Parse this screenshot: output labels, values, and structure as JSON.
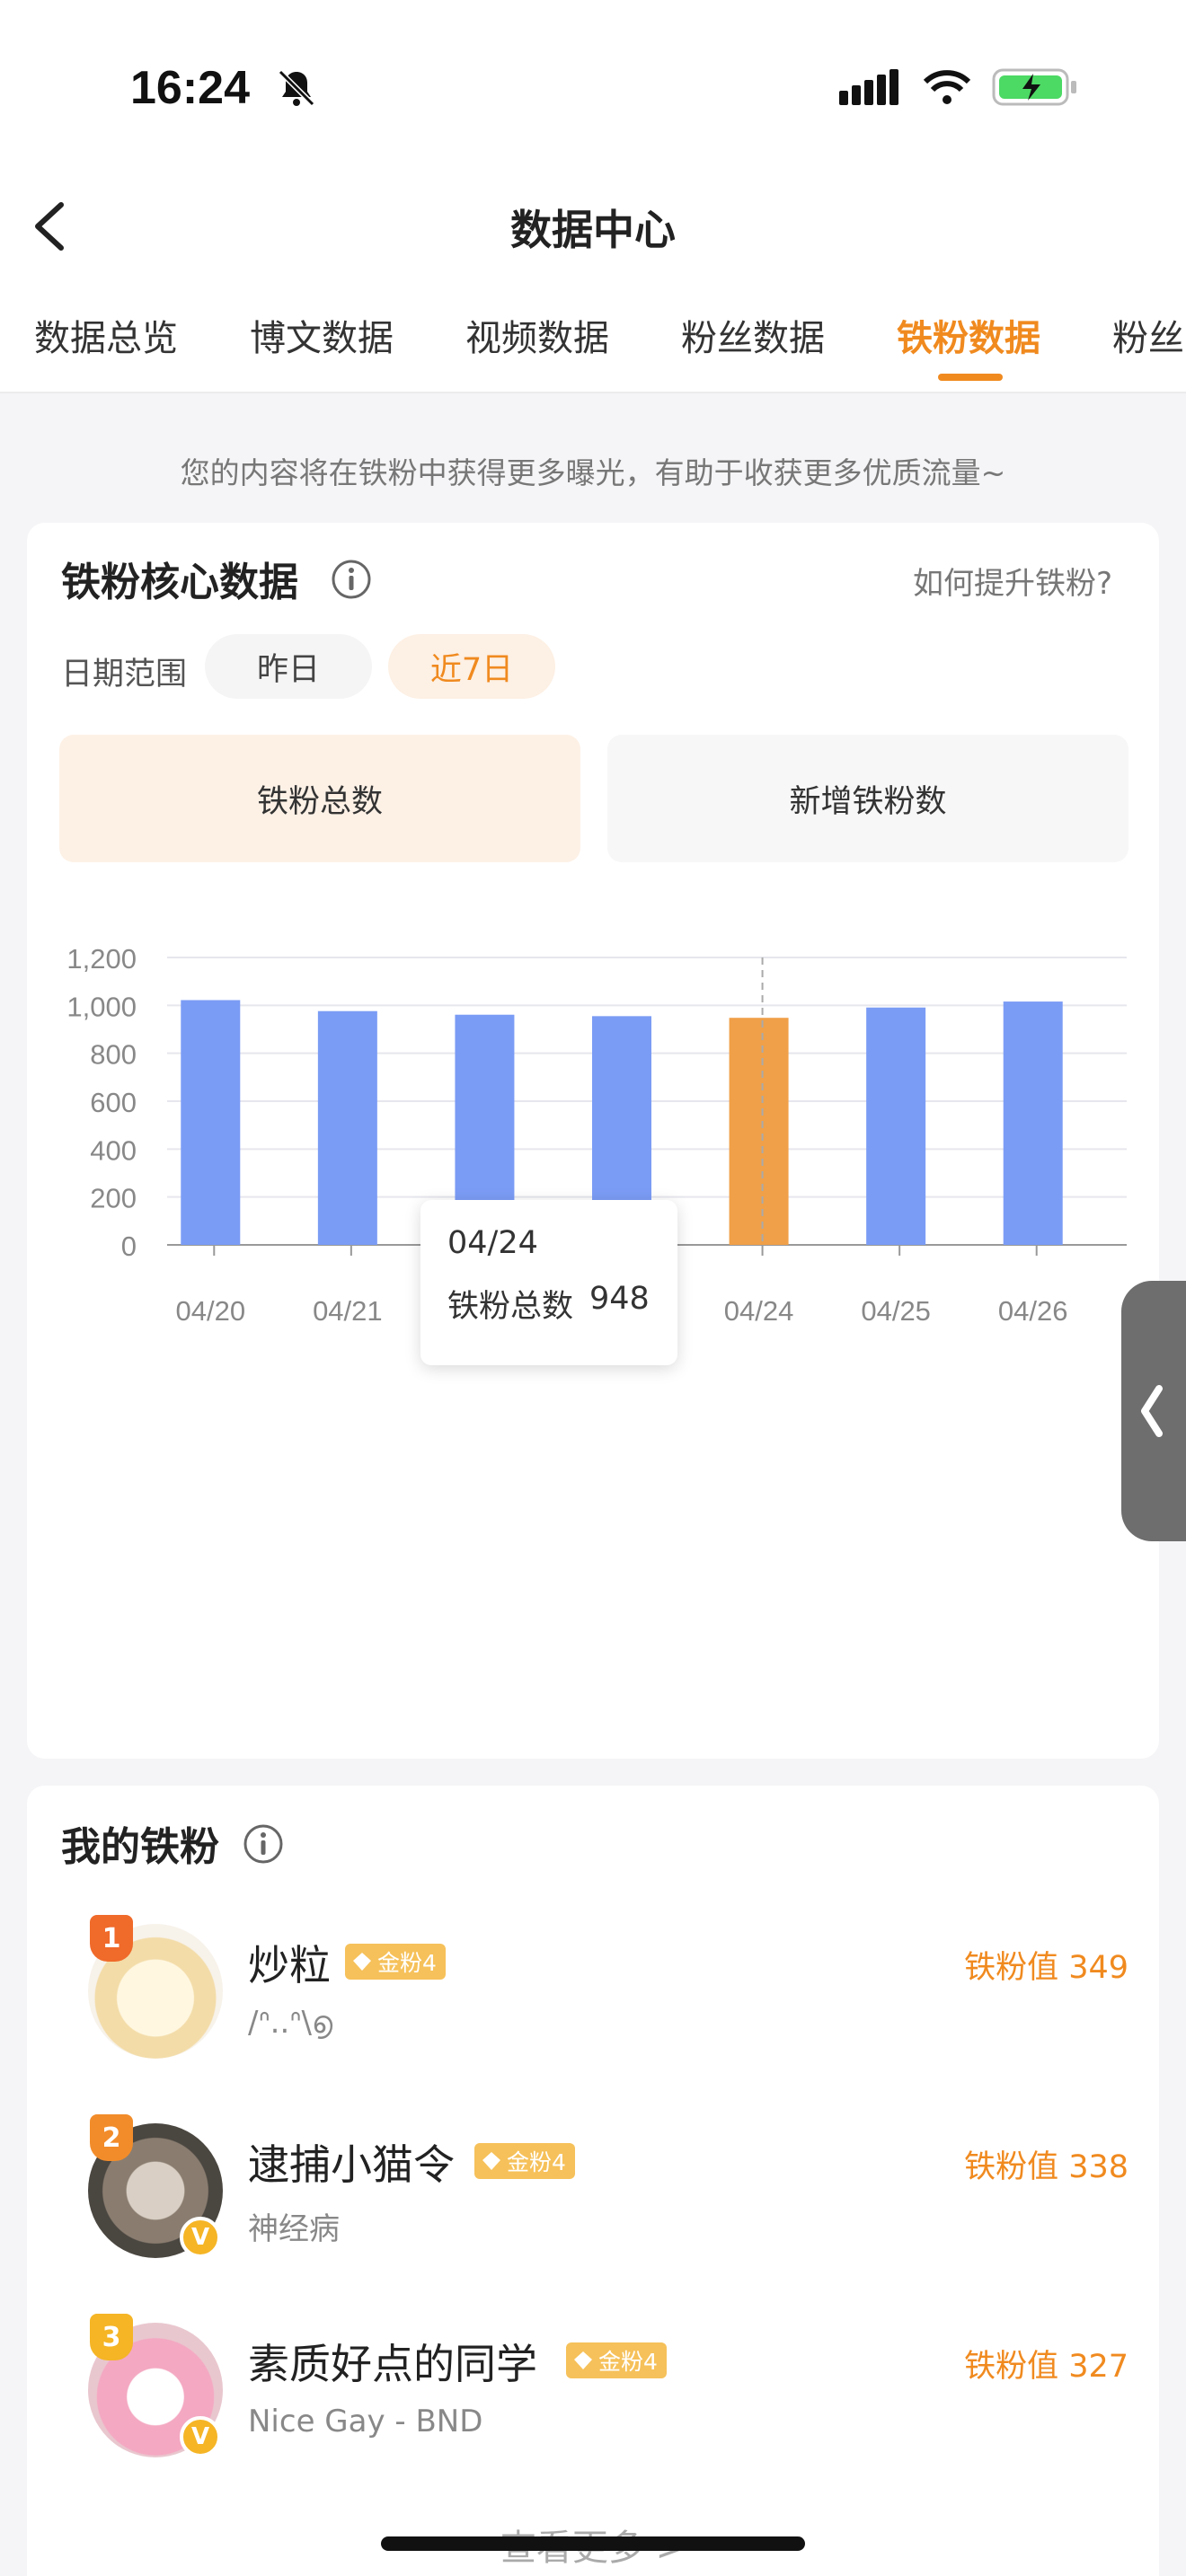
{
  "status": {
    "time": "16:24"
  },
  "nav": {
    "title": "数据中心"
  },
  "tabs": [
    {
      "label": "数据总览",
      "active": false
    },
    {
      "label": "博文数据",
      "active": false
    },
    {
      "label": "视频数据",
      "active": false
    },
    {
      "label": "粉丝数据",
      "active": false
    },
    {
      "label": "铁粉数据",
      "active": true
    },
    {
      "label": "粉丝",
      "active": false
    }
  ],
  "notice": "您的内容将在铁粉中获得更多曝光，有助于收获更多优质流量~",
  "core": {
    "title": "铁粉核心数据",
    "howto": "如何提升铁粉?",
    "date_label": "日期范围",
    "range_yesterday": "昨日",
    "range_7days": "近7日",
    "metric_total": "铁粉总数",
    "metric_new": "新增铁粉数"
  },
  "chart_data": {
    "type": "bar",
    "categories": [
      "04/20",
      "04/21",
      "04/22",
      "04/23",
      "04/24",
      "04/25",
      "04/26"
    ],
    "values": [
      1022,
      976,
      961,
      955,
      948,
      991,
      1016
    ],
    "ylim": [
      0,
      1200
    ],
    "yticks": [
      "0",
      "200",
      "400",
      "600",
      "800",
      "1,000",
      "1,200"
    ],
    "highlight_index": 4,
    "colors": {
      "bar": "#7b9cf5",
      "highlight": "#f0a048",
      "grid": "#e6e6ee"
    },
    "tooltip": {
      "date": "04/24",
      "label": "铁粉总数",
      "value": "948"
    }
  },
  "my_fans": {
    "title": "我的铁粉",
    "items": [
      {
        "rank": "1",
        "name": "炒粒",
        "badge": "金粉4",
        "desc": "/ᐢ..ᐢ\\൭",
        "score": "铁粉值 349",
        "verified": false,
        "rank_color": "#f06a2a"
      },
      {
        "rank": "2",
        "name": "逮捕小猫令",
        "badge": "金粉4",
        "desc": "神经病",
        "score": "铁粉值 338",
        "verified": true,
        "rank_color": "#f28c2a"
      },
      {
        "rank": "3",
        "name": "素质好点的同学",
        "badge": "金粉4",
        "desc": "Nice Gay - BND",
        "score": "铁粉值 327",
        "verified": true,
        "rank_color": "#f5b525"
      }
    ],
    "more": "查看更多 >"
  },
  "icons": {
    "back": "chevron-left-icon",
    "bell_off": "bell-off-icon",
    "info": "info-icon",
    "handle": "chevron-left-icon"
  }
}
